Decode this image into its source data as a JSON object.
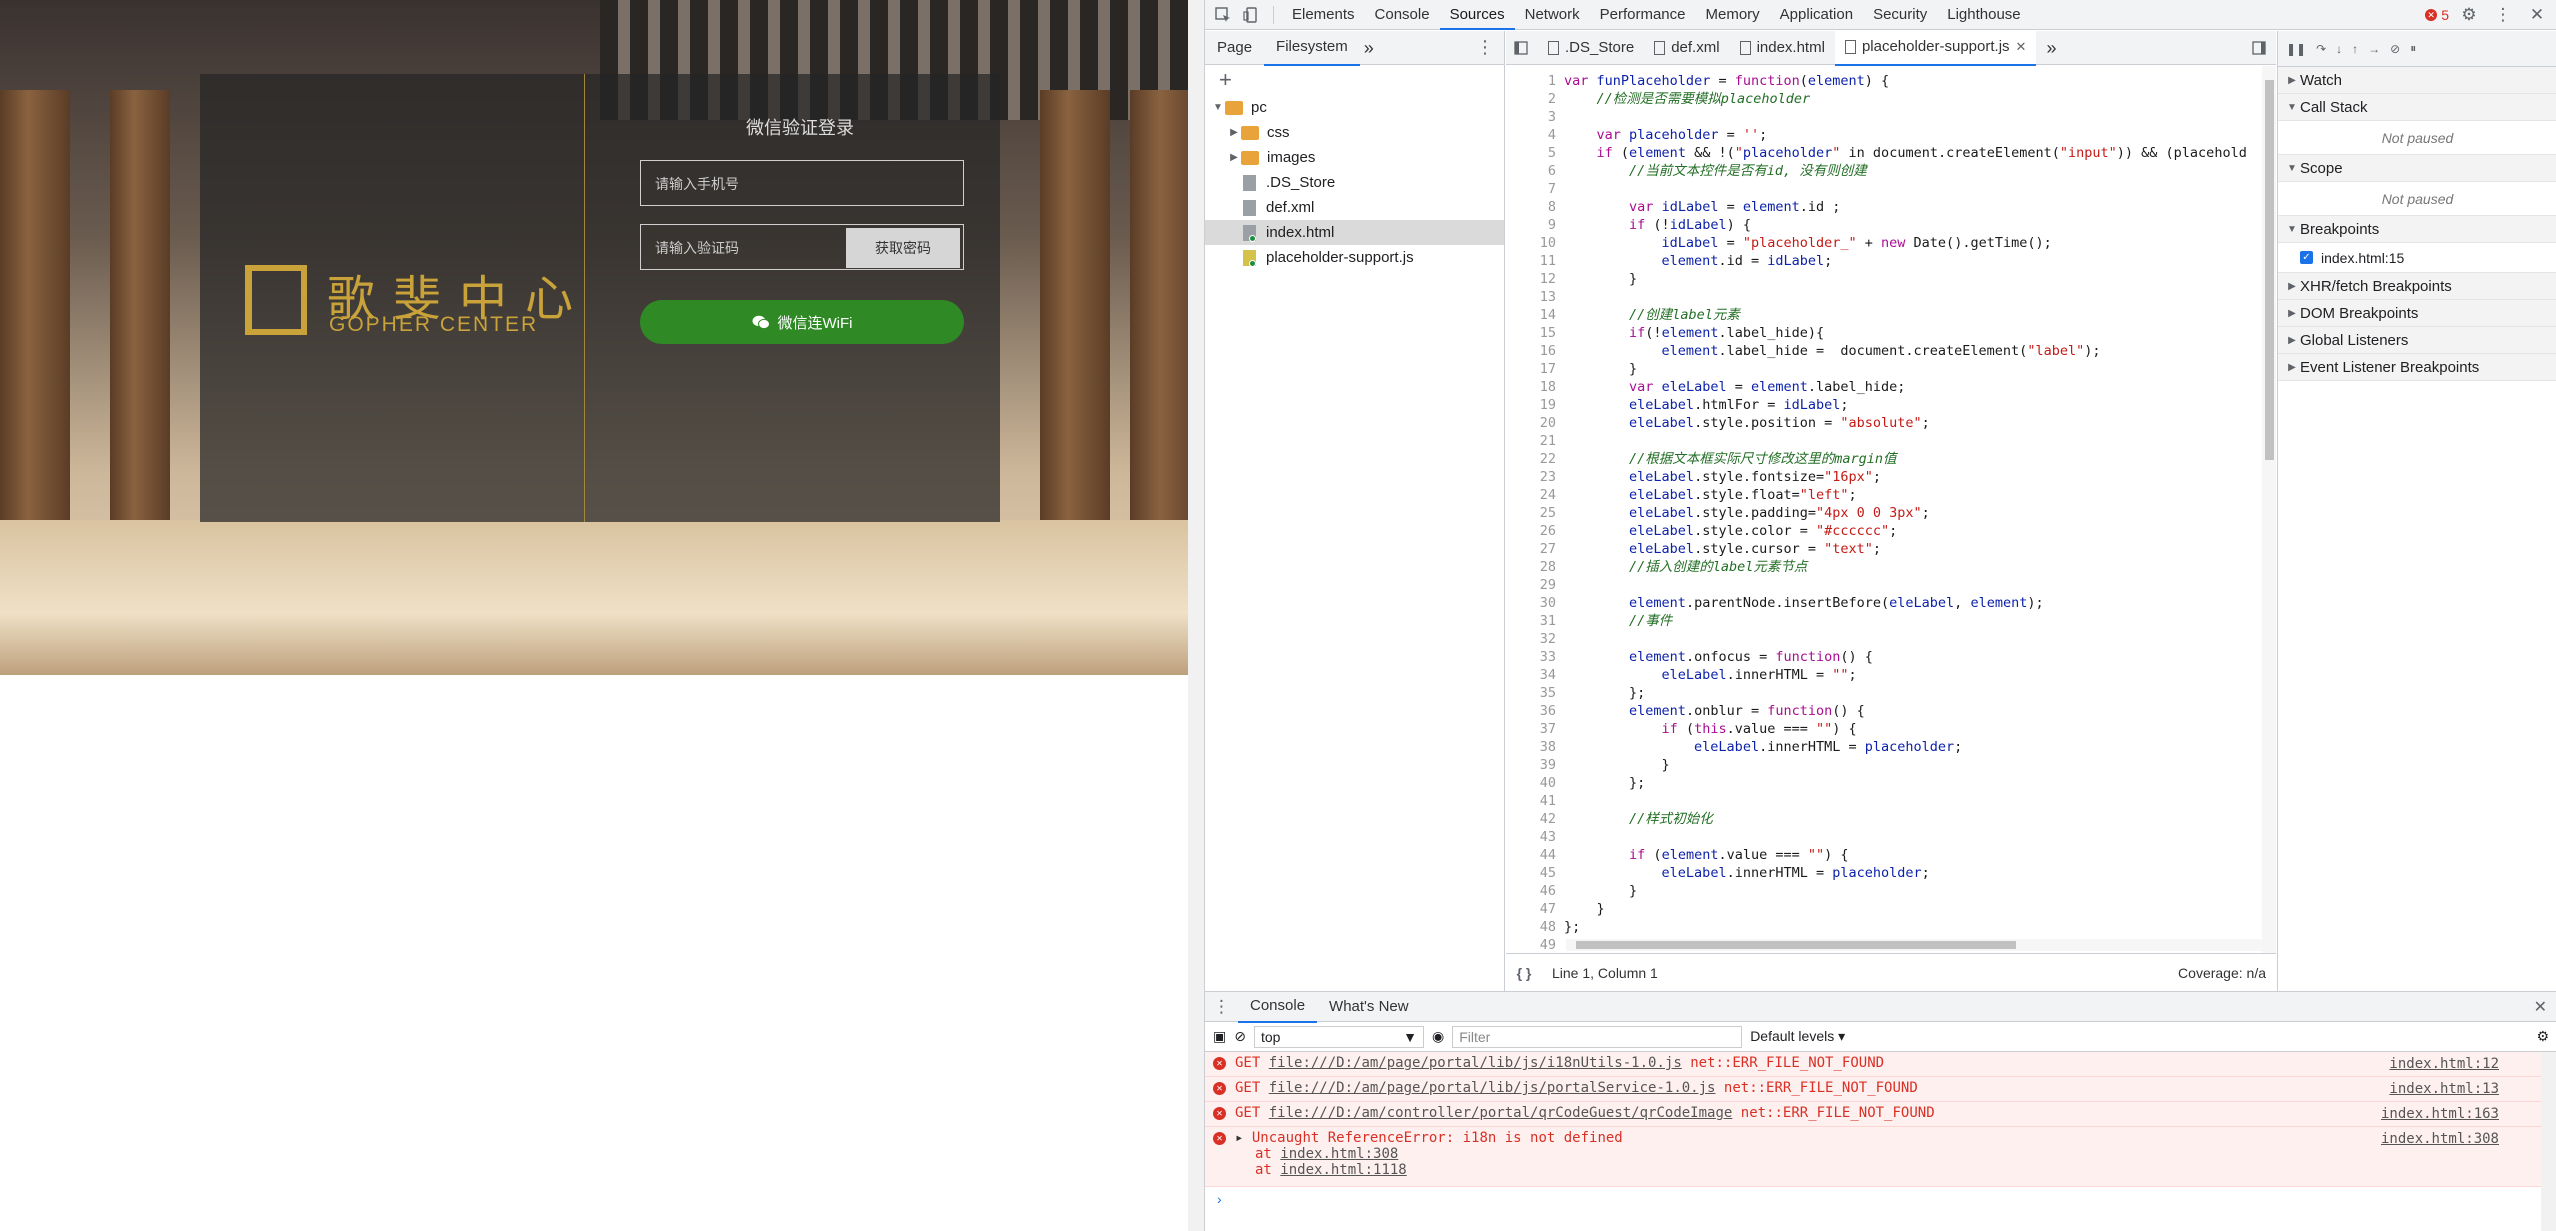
{
  "page": {
    "login_title": "微信验证登录",
    "phone_placeholder": "请输入手机号",
    "code_placeholder": "请输入验证码",
    "sms_button": "获取密码",
    "wifi_button": "微信连WiFi",
    "logo_cn": "歌斐中心",
    "logo_en": "GOPHER CENTER"
  },
  "devtools": {
    "tabs": [
      "Elements",
      "Console",
      "Sources",
      "Network",
      "Performance",
      "Memory",
      "Application",
      "Security",
      "Lighthouse"
    ],
    "active_tab": "Sources",
    "error_count": "5",
    "navigator": {
      "tabs": [
        "Page",
        "Filesystem"
      ],
      "active": "Filesystem",
      "tree": [
        {
          "label": "pc",
          "type": "folder"
        },
        {
          "label": "css",
          "type": "folder"
        },
        {
          "label": "images",
          "type": "folder"
        },
        {
          "label": ".DS_Store",
          "type": "file"
        },
        {
          "label": "def.xml",
          "type": "file"
        },
        {
          "label": "index.html",
          "type": "file"
        },
        {
          "label": "placeholder-support.js",
          "type": "js"
        }
      ]
    },
    "editor_tabs": [
      ".DS_Store",
      "def.xml",
      "index.html",
      "placeholder-support.js"
    ],
    "editor_active": "placeholder-support.js",
    "cursor_pos": "Line 1, Column 1",
    "coverage": "Coverage: n/a",
    "code_lines": [
      "var funPlaceholder = function(element) {",
      "    //检测是否需要模拟placeholder",
      "",
      "    var placeholder = '';",
      "    if (element && !(\"placeholder\" in document.createElement(\"input\")) && (placehold",
      "        //当前文本控件是否有id, 没有则创建",
      "",
      "        var idLabel = element.id ;",
      "        if (!idLabel) {",
      "            idLabel = \"placeholder_\" + new Date().getTime();",
      "            element.id = idLabel;",
      "        }",
      "",
      "        //创建label元素",
      "        if(!element.label_hide){",
      "            element.label_hide =  document.createElement(\"label\");",
      "        }",
      "        var eleLabel = element.label_hide;",
      "        eleLabel.htmlFor = idLabel;",
      "        eleLabel.style.position = \"absolute\";",
      "",
      "        //根据文本框实际尺寸修改这里的margin值",
      "        eleLabel.style.fontsize=\"16px\";",
      "        eleLabel.style.float=\"left\";",
      "        eleLabel.style.padding=\"4px 0 0 3px\";",
      "        eleLabel.style.color = \"#cccccc\";",
      "        eleLabel.style.cursor = \"text\";",
      "        //插入创建的label元素节点",
      "",
      "        element.parentNode.insertBefore(eleLabel, element);",
      "        //事件",
      "",
      "        element.onfocus = function() {",
      "            eleLabel.innerHTML = \"\";",
      "        };",
      "        element.onblur = function() {",
      "            if (this.value === \"\") {",
      "                eleLabel.innerHTML = placeholder;",
      "            }",
      "        };",
      "",
      "        //样式初始化",
      "",
      "        if (element.value === \"\") {",
      "            eleLabel.innerHTML = placeholder;",
      "        }",
      "    }",
      "};",
      ""
    ],
    "debugger": {
      "watch": "Watch",
      "call_stack": "Call Stack",
      "not_paused": "Not paused",
      "scope": "Scope",
      "breakpoints": "Breakpoints",
      "bp_item": "index.html:15",
      "xhr": "XHR/fetch Breakpoints",
      "dom": "DOM Breakpoints",
      "global": "Global Listeners",
      "event": "Event Listener Breakpoints"
    },
    "drawer": {
      "tabs": [
        "Console",
        "What's New"
      ],
      "context": "top",
      "filter_placeholder": "Filter",
      "levels": "Default levels",
      "errors": [
        {
          "method": "GET",
          "url": "file:///D:/am/page/portal/lib/js/i18nUtils-1.0.js",
          "msg": "net::ERR_FILE_NOT_FOUND",
          "src": "index.html:12"
        },
        {
          "method": "GET",
          "url": "file:///D:/am/page/portal/lib/js/portalService-1.0.js",
          "msg": "net::ERR_FILE_NOT_FOUND",
          "src": "index.html:13"
        },
        {
          "method": "GET",
          "url": "file:///D:/am/controller/portal/qrCodeGuest/qrCodeImage",
          "msg": "net::ERR_FILE_NOT_FOUND",
          "src": "index.html:163"
        }
      ],
      "uncaught": {
        "msg": "Uncaught ReferenceError: i18n is not defined",
        "at1": "index.html:308",
        "at2": "index.html:1118",
        "src": "index.html:308"
      }
    }
  },
  "colors": {
    "accent": "#1a73e8",
    "error": "#d93025",
    "wechat": "#2f8a25",
    "gold": "#c9a23a"
  }
}
